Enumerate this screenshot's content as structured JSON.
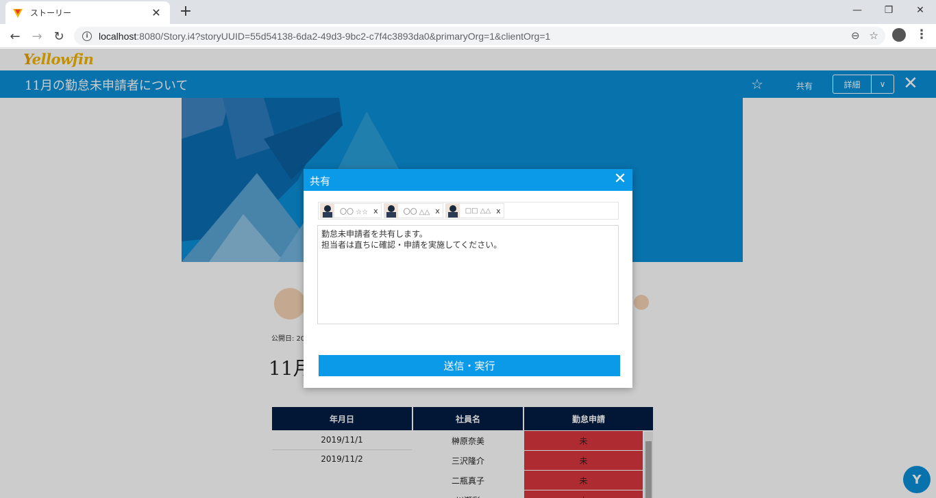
{
  "browser": {
    "tab_title": "ストーリー",
    "tab_close": "✕",
    "new_tab": "+",
    "url_host": "localhost",
    "url_rest": ":8080/Story.i4?storyUUID=55d54138-6da2-49d3-9bc2-c7f4c3893da0&primaryOrg=1&clientOrg=1",
    "win_min": "—",
    "win_restore": "❐",
    "win_close": "✕",
    "back": "←",
    "forward": "→",
    "reload": "↻",
    "zoom_icon": "⊖",
    "star_icon": "☆",
    "menu": "⋮"
  },
  "app": {
    "logo_y": "Y",
    "logo_rest": "ellowfin",
    "story_title": "11月の勤怠未申請者について",
    "share_label": "共有",
    "detail_label": "詳細",
    "detail_chevron": "∨",
    "close": "✕",
    "star": "☆",
    "meta": "公開日: 20",
    "heading": "11月",
    "help_icon": "Y"
  },
  "table": {
    "headers": [
      "年月日",
      "社員名",
      "勤怠申請"
    ],
    "rows": [
      {
        "date": "2019/11/1",
        "name": "榊原奈美",
        "status": "未"
      },
      {
        "date": "2019/11/2",
        "name": "三沢隆介",
        "status": "未"
      },
      {
        "date": "",
        "name": "二瓶真子",
        "status": "未"
      },
      {
        "date": "",
        "name": "川瀬彩",
        "status": "未"
      }
    ]
  },
  "modal": {
    "title": "共有",
    "close": "✕",
    "recipients": [
      {
        "name": "〇〇 ☆☆",
        "remove": "x"
      },
      {
        "name": "〇〇 △△",
        "remove": "x"
      },
      {
        "name": "□□ △△",
        "remove": "x"
      }
    ],
    "message": "勤怠未申請者を共有します。\n担当者は直ちに確認・申請を実施してください。",
    "send_label": "送信・実行"
  },
  "colors": {
    "brand_blue": "#0a8fd8",
    "modal_blue": "#0a9ae8",
    "table_header": "#031d44",
    "status_red": "#d9363e",
    "logo_yellow": "#f4b400"
  }
}
